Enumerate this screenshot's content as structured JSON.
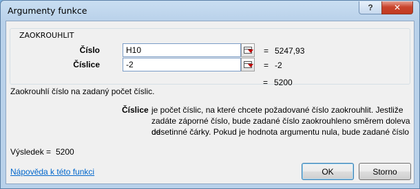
{
  "window": {
    "title": "Argumenty funkce",
    "help_label": "?",
    "close_label": "✕"
  },
  "function_group": {
    "name": "ZAOKROUHLIT",
    "args": [
      {
        "label": "Číslo",
        "value": "H10",
        "equals": "=",
        "result": "5247,93"
      },
      {
        "label": "Číslice",
        "value": "-2",
        "equals": "=",
        "result": "-2"
      }
    ]
  },
  "formula_result": {
    "equals": "=",
    "value": "5200"
  },
  "description": {
    "function_text": "Zaokrouhlí číslo na zadaný počet číslic.",
    "arg_name": "Číslice",
    "arg_lines": [
      "je počet číslic, na které chcete požadované číslo zaokrouhlit. Jestliže",
      "zadáte záporné číslo, bude zadané číslo zaokrouhleno směrem doleva od",
      "desetinné čárky. Pokud je hodnota argumentu nula, bude zadané číslo"
    ]
  },
  "result": {
    "label": "Výsledek =",
    "value": "5200"
  },
  "help_link": "Nápověda k této funkci",
  "buttons": {
    "ok": "OK",
    "cancel": "Storno"
  }
}
